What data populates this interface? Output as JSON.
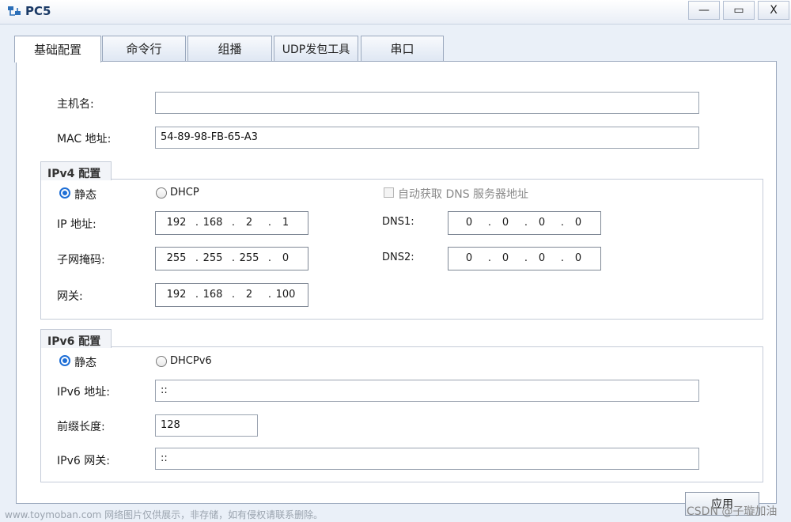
{
  "window": {
    "title": "PC5",
    "minimize_label": "—",
    "maximize_label": "▭",
    "close_label": "X"
  },
  "tabs": [
    {
      "label": "基础配置",
      "active": true
    },
    {
      "label": "命令行"
    },
    {
      "label": "组播"
    },
    {
      "label": "UDP发包工具"
    },
    {
      "label": "串口"
    }
  ],
  "basic": {
    "hostname_label": "主机名:",
    "hostname_value": "",
    "mac_label": "MAC 地址:",
    "mac_value": "54-89-98-FB-65-A3"
  },
  "ipv4": {
    "group_title": "IPv4 配置",
    "static_label": "静态",
    "dhcp_label": "DHCP",
    "auto_dns_label": "自动获取 DNS 服务器地址",
    "ip_label": "IP 地址:",
    "ip": [
      "192",
      "168",
      "2",
      "1"
    ],
    "mask_label": "子网掩码:",
    "mask": [
      "255",
      "255",
      "255",
      "0"
    ],
    "gateway_label": "网关:",
    "gateway": [
      "192",
      "168",
      "2",
      "100"
    ],
    "dns1_label": "DNS1:",
    "dns1": [
      "0",
      "0",
      "0",
      "0"
    ],
    "dns2_label": "DNS2:",
    "dns2": [
      "0",
      "0",
      "0",
      "0"
    ]
  },
  "ipv6": {
    "group_title": "IPv6 配置",
    "static_label": "静态",
    "dhcpv6_label": "DHCPv6",
    "addr_label": "IPv6 地址:",
    "addr_value": "::",
    "prefix_label": "前缀长度:",
    "prefix_value": "128",
    "gateway_label": "IPv6 网关:",
    "gateway_value": "::"
  },
  "apply_label": "应用",
  "watermark": {
    "left": "www.toymoban.com 网络图片仅供展示，非存储，如有侵权请联系删除。",
    "right": "CSDN @子璇加油"
  },
  "colors": {
    "accent": "#1f6fd6",
    "title_text": "#1b3a66"
  }
}
